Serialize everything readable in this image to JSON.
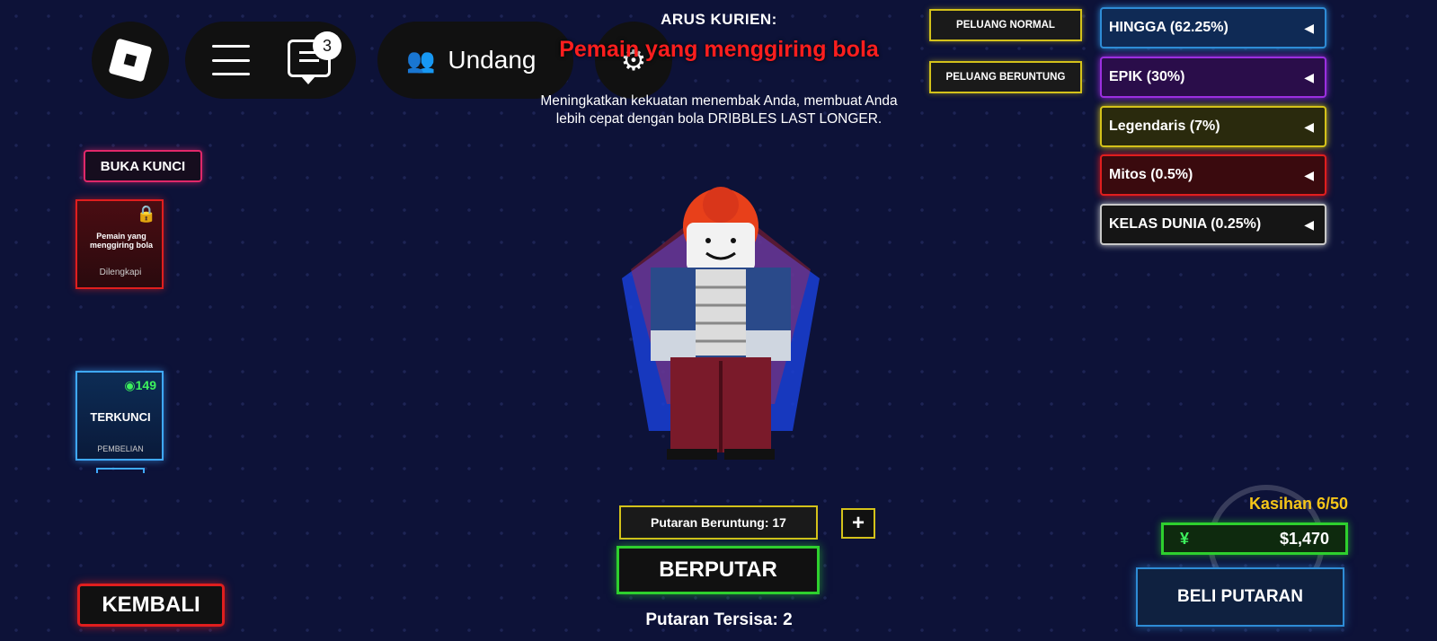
{
  "topbar": {
    "chat_badge": "3",
    "invite_label": "Undang",
    "invite_icon": "👥"
  },
  "current": {
    "label": "ARUS KURIEN:",
    "name": "Pemain yang menggiring bola",
    "description": "Meningkatkan kekuatan menembak Anda, membuat Anda lebih cepat dengan bola DRIBBLES LAST LONGER."
  },
  "odds": {
    "normal": "PELUANG NORMAL",
    "lucky": "PELUANG BERUNTUNG"
  },
  "rarities": [
    {
      "label": "HINGGA (62.25%)",
      "color": "#2e8cd6",
      "bg": "#0f2a55"
    },
    {
      "label": "EPIK (30%)",
      "color": "#9b2fe0",
      "bg": "#2a0d4a"
    },
    {
      "label": "Legendaris (7%)",
      "color": "#d4c21a",
      "bg": "#2a2a0d"
    },
    {
      "label": "Mitos (0.5%)",
      "color": "#e01e1e",
      "bg": "#3a0a0e"
    },
    {
      "label": "KELAS DUNIA (0.25%)",
      "color": "#c8c8c8",
      "bg": "#151515"
    }
  ],
  "left": {
    "unlock_label": "BUKA KUNCI",
    "card_red": {
      "name": "Pemain yang menggiring bola",
      "status": "Dilengkapi"
    },
    "card_blue": {
      "price": "149",
      "label": "TERKUNCI",
      "sub": "PEMBELIAN"
    },
    "back_label": "KEMBALI"
  },
  "spin": {
    "lucky_spins": "Putaran Beruntung: 17",
    "plus": "+",
    "spin_label": "BERPUTAR",
    "spins_left": "Putaran Tersisa: 2"
  },
  "shop": {
    "pity": "Kasihan 6/50",
    "currency_symbol": "¥",
    "money": "$1,470",
    "buy_label": "BELI PUTARAN"
  }
}
